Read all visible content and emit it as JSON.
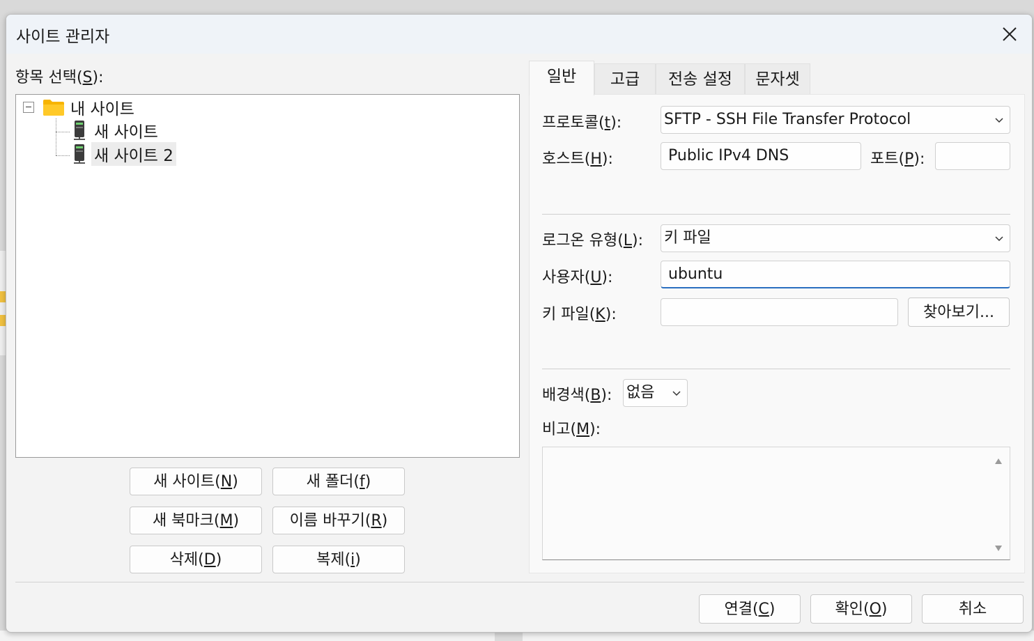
{
  "dialog": {
    "title": "사이트 관리자",
    "close_icon": "close-icon"
  },
  "left": {
    "tree_label_pre": "항목 선택(",
    "tree_label_key": "S",
    "tree_label_post": "):",
    "tree": {
      "root": "내 사이트",
      "items": [
        "새 사이트",
        "새 사이트 2"
      ],
      "selected": "새 사이트 2"
    },
    "buttons": {
      "new_site": {
        "pre": "새 사이트(",
        "key": "N",
        "post": ")"
      },
      "new_folder": {
        "pre": "새 폴더(",
        "key": "f",
        "post": ")"
      },
      "new_bookmark": {
        "pre": "새 북마크(",
        "key": "M",
        "post": ")"
      },
      "rename": {
        "pre": "이름 바꾸기(",
        "key": "R",
        "post": ")"
      },
      "delete": {
        "pre": "삭제(",
        "key": "D",
        "post": ")"
      },
      "duplicate": {
        "pre": "복제(",
        "key": "i",
        "post": ")"
      }
    }
  },
  "tabs": [
    "일반",
    "고급",
    "전송 설정",
    "문자셋"
  ],
  "general": {
    "protocol": {
      "label_pre": "프로토콜(",
      "key": "t",
      "label_post": "):",
      "value": "SFTP - SSH File Transfer Protocol"
    },
    "host": {
      "label_pre": "호스트(",
      "key": "H",
      "label_post": "):",
      "value": "Public IPv4 DNS"
    },
    "port": {
      "label_pre": "포트(",
      "key": "P",
      "label_post": "):",
      "value": ""
    },
    "logon_type": {
      "label_pre": "로그온 유형(",
      "key": "L",
      "label_post": "):",
      "value": "키 파일"
    },
    "user": {
      "label_pre": "사용자(",
      "key": "U",
      "label_post": "):",
      "value": "ubuntu"
    },
    "key_file": {
      "label_pre": "키 파일(",
      "key": "K",
      "label_post": "):",
      "value": ""
    },
    "browse": "찾아보기...",
    "bg_color": {
      "label_pre": "배경색(",
      "key": "B",
      "label_post": "):",
      "value": "없음"
    },
    "comments": {
      "label_pre": "비고(",
      "key": "M",
      "label_post": "):",
      "value": ""
    }
  },
  "footer": {
    "connect": {
      "pre": "연결(",
      "key": "C",
      "post": ")"
    },
    "ok": {
      "pre": "확인(",
      "key": "O",
      "post": ")"
    },
    "cancel": "취소"
  }
}
